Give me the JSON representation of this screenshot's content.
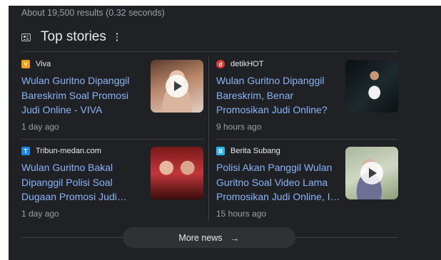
{
  "results_stats": "About 19,500 results (0.32 seconds)",
  "section": {
    "title": "Top stories",
    "icon": "newspaper-icon"
  },
  "stories": [
    {
      "source": "Viva",
      "favicon_color": "#f59e0b",
      "headline": "Wulan Guritno Dipanggil Bareskrim Soal Promosi Judi Online - VIVA",
      "time": "1 day ago",
      "has_video": true
    },
    {
      "source": "detikHOT",
      "favicon_color": "#e53935",
      "headline": "Wulan Guritno Dipanggil Bareskrim, Benar Promosikan Judi Online?",
      "time": "9 hours ago",
      "has_video": false
    },
    {
      "source": "Tribun-medan.com",
      "favicon_color": "#1e88e5",
      "headline": "Wulan Guritno Bakal Dipanggil Polisi Soal Dugaan Promosi Judi Online",
      "time": "1 day ago",
      "has_video": false
    },
    {
      "source": "Berita Subang",
      "favicon_color": "#29b6f6",
      "headline": "Polisi Akan Panggil Wulan Guritno Soal Video Lama Promosikan Judi Online, Ini Kata Dia",
      "time": "15 hours ago",
      "has_video": true
    }
  ],
  "more_news": {
    "label": "More news",
    "arrow": "→"
  }
}
